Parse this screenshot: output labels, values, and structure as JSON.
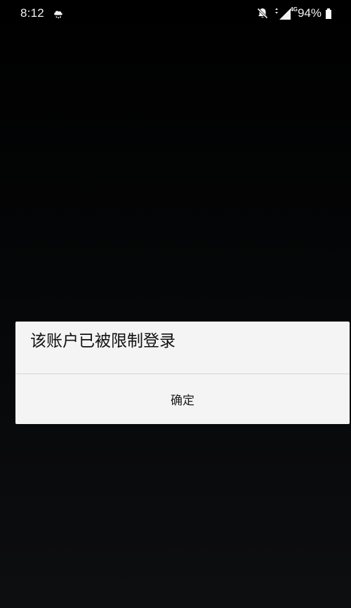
{
  "status_bar": {
    "time": "8:12",
    "weather_icon": "cloud-rain-icon",
    "notification_icon": "bell-off-icon",
    "network_type": "4G",
    "battery_percent": "94%",
    "battery_level": 0.94
  },
  "dialog": {
    "message": "该账户已被限制登录",
    "confirm_label": "确定"
  },
  "colors": {
    "background": "#000000",
    "dialog_background": "#f4f4f4",
    "dialog_text": "#111111",
    "divider": "#d5d5d5"
  }
}
